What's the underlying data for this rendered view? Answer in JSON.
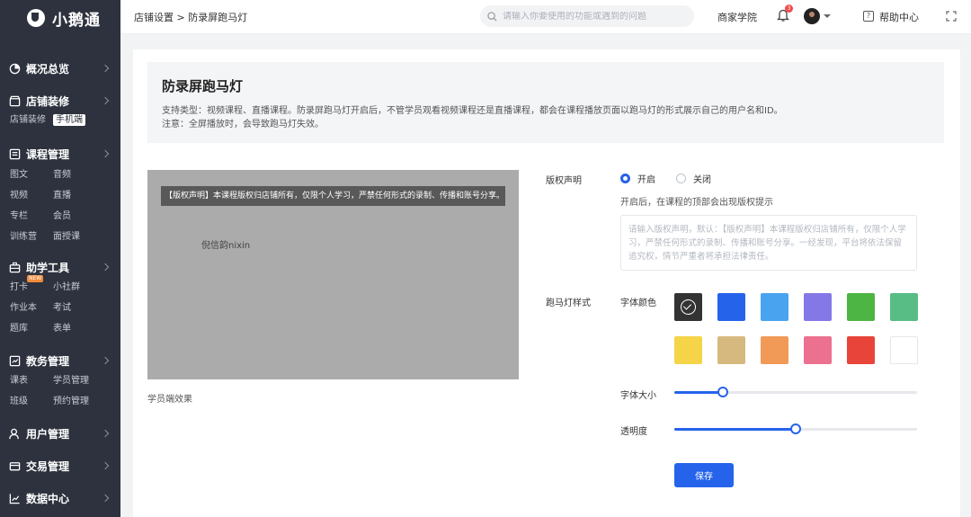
{
  "brand": {
    "name": "小鹅通"
  },
  "sidebar": {
    "groups": [
      {
        "title": "概况总览",
        "icon": "overview-icon",
        "subs": []
      },
      {
        "title": "店铺装修",
        "icon": "store-icon",
        "subs": [
          "店铺装修",
          "手机端"
        ]
      },
      {
        "title": "课程管理",
        "icon": "course-icon",
        "subs": [
          "图文",
          "音频",
          "视频",
          "直播",
          "专栏",
          "会员",
          "训练营",
          "面授课"
        ]
      },
      {
        "title": "助学工具",
        "icon": "toolbox-icon",
        "subs": [
          "打卡",
          "小社群",
          "作业本",
          "考试",
          "题库",
          "表单"
        ],
        "new_badge": "NEW"
      },
      {
        "title": "教务管理",
        "icon": "academic-icon",
        "subs": [
          "课表",
          "学员管理",
          "班级",
          "预约管理"
        ]
      },
      {
        "title": "用户管理",
        "icon": "user-icon",
        "subs": []
      },
      {
        "title": "交易管理",
        "icon": "trade-icon",
        "subs": []
      },
      {
        "title": "数据中心",
        "icon": "chart-icon",
        "subs": []
      }
    ]
  },
  "topbar": {
    "breadcrumb": "店铺设置 > 防录屏跑马灯",
    "search_placeholder": "请输入你要使用的功能或遇到的问题",
    "academy": "商家学院",
    "notification_count": "3",
    "help": "帮助中心"
  },
  "intro": {
    "title": "防录屏跑马灯",
    "line1": "支持类型：视频课程、直播课程。防录屏跑马灯开启后，不管学员观看视频课程还是直播课程，都会在课程播放页面以跑马灯的形式展示自己的用户名和ID。",
    "line2": "注意：全屏播放时，会导致跑马灯失效。"
  },
  "preview": {
    "banner": "【版权声明】本课程版权归店铺所有，仅限个人学习，严禁任何形式的录制、传播和账号分享。",
    "marquee_text": "倪信韵nixin",
    "caption": "学员端效果"
  },
  "settings": {
    "copyright_label": "版权声明",
    "on_label": "开启",
    "off_label": "关闭",
    "copyright_enabled": true,
    "copyright_hint": "开启后，在课程的顶部会出现版权提示",
    "copyright_placeholder": "请输入版权声明，默认：【版权声明】本课程版权归店铺所有，仅限个人学习，严禁任何形式的录制、传播和账号分享。一经发现，平台将依法保留追究权，情节严重者将承担法律责任。",
    "marquee_style_label": "跑马灯样式",
    "font_color_label": "字体颜色",
    "font_size_label": "字体大小",
    "opacity_label": "透明度",
    "font_size_value": 0.2,
    "opacity_value": 0.5,
    "colors": [
      "#333333",
      "#2563eb",
      "#4aa3ef",
      "#8478e6",
      "#4cb543",
      "#57bd85",
      "#f5d448",
      "#d6b97f",
      "#f19a58",
      "#ec7090",
      "#e8443a",
      "#ffffff"
    ],
    "selected_color": 0,
    "save_label": "保存"
  }
}
